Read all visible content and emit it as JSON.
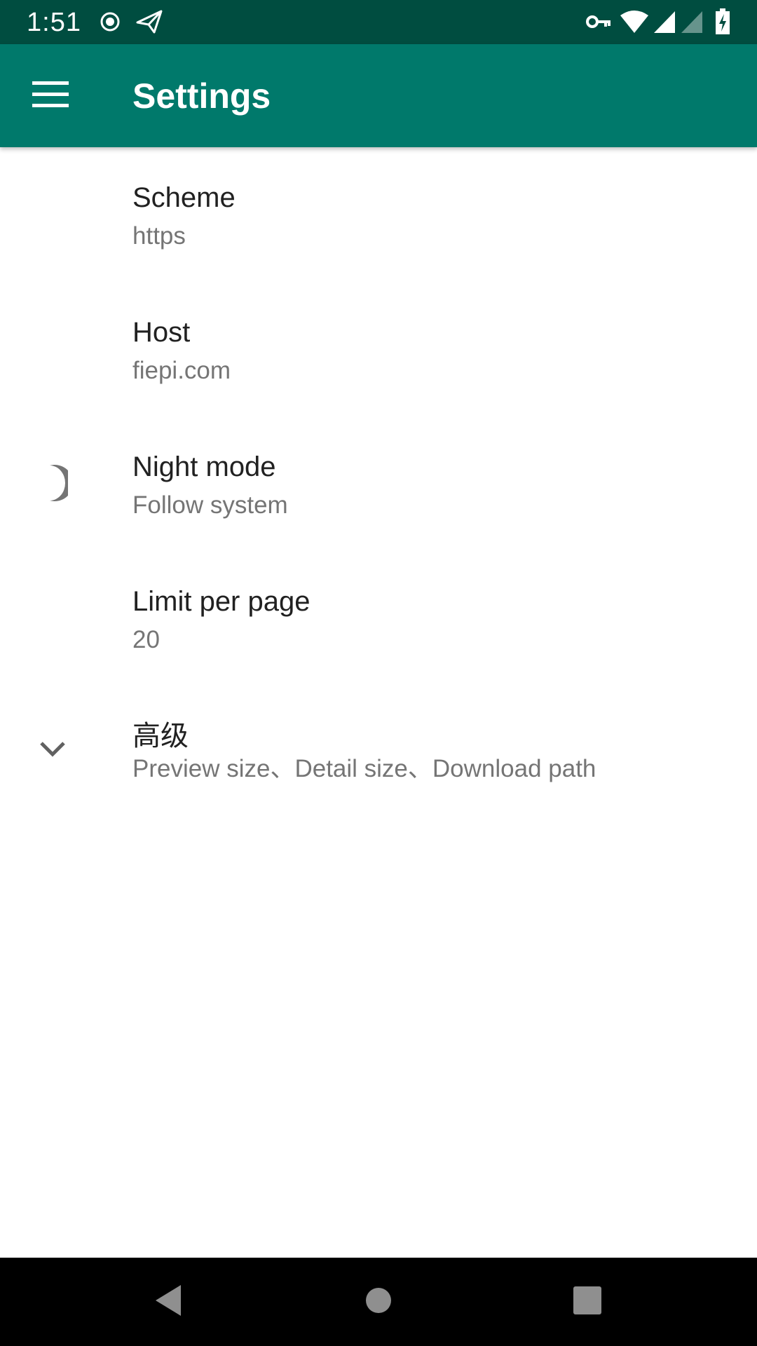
{
  "status_bar": {
    "time": "1:51",
    "left_icons": [
      "record-icon",
      "send-icon"
    ],
    "right_icons": [
      "vpn-key-icon",
      "wifi-icon",
      "signal-icon",
      "signal-weak-icon",
      "battery-charging-icon"
    ]
  },
  "app_bar": {
    "title": "Settings",
    "menu_icon": "hamburger-menu-icon",
    "color": "#00796b"
  },
  "settings": [
    {
      "title": "Scheme",
      "summary": "https",
      "icon": null
    },
    {
      "title": "Host",
      "summary": "fiepi.com",
      "icon": null
    },
    {
      "title": "Night mode",
      "summary": "Follow system",
      "icon": "moon-icon"
    },
    {
      "title": "Limit per page",
      "summary": "20",
      "icon": null
    },
    {
      "title": "高级",
      "summary": "Preview size、Detail size、Download path",
      "icon": "chevron-down-icon"
    }
  ],
  "nav_bar": {
    "buttons": [
      "back-icon",
      "home-icon",
      "recents-icon"
    ]
  },
  "colors": {
    "status_bar": "#004d40",
    "app_bar": "#00796b",
    "title_text": "#212121",
    "summary_text": "#757575"
  }
}
